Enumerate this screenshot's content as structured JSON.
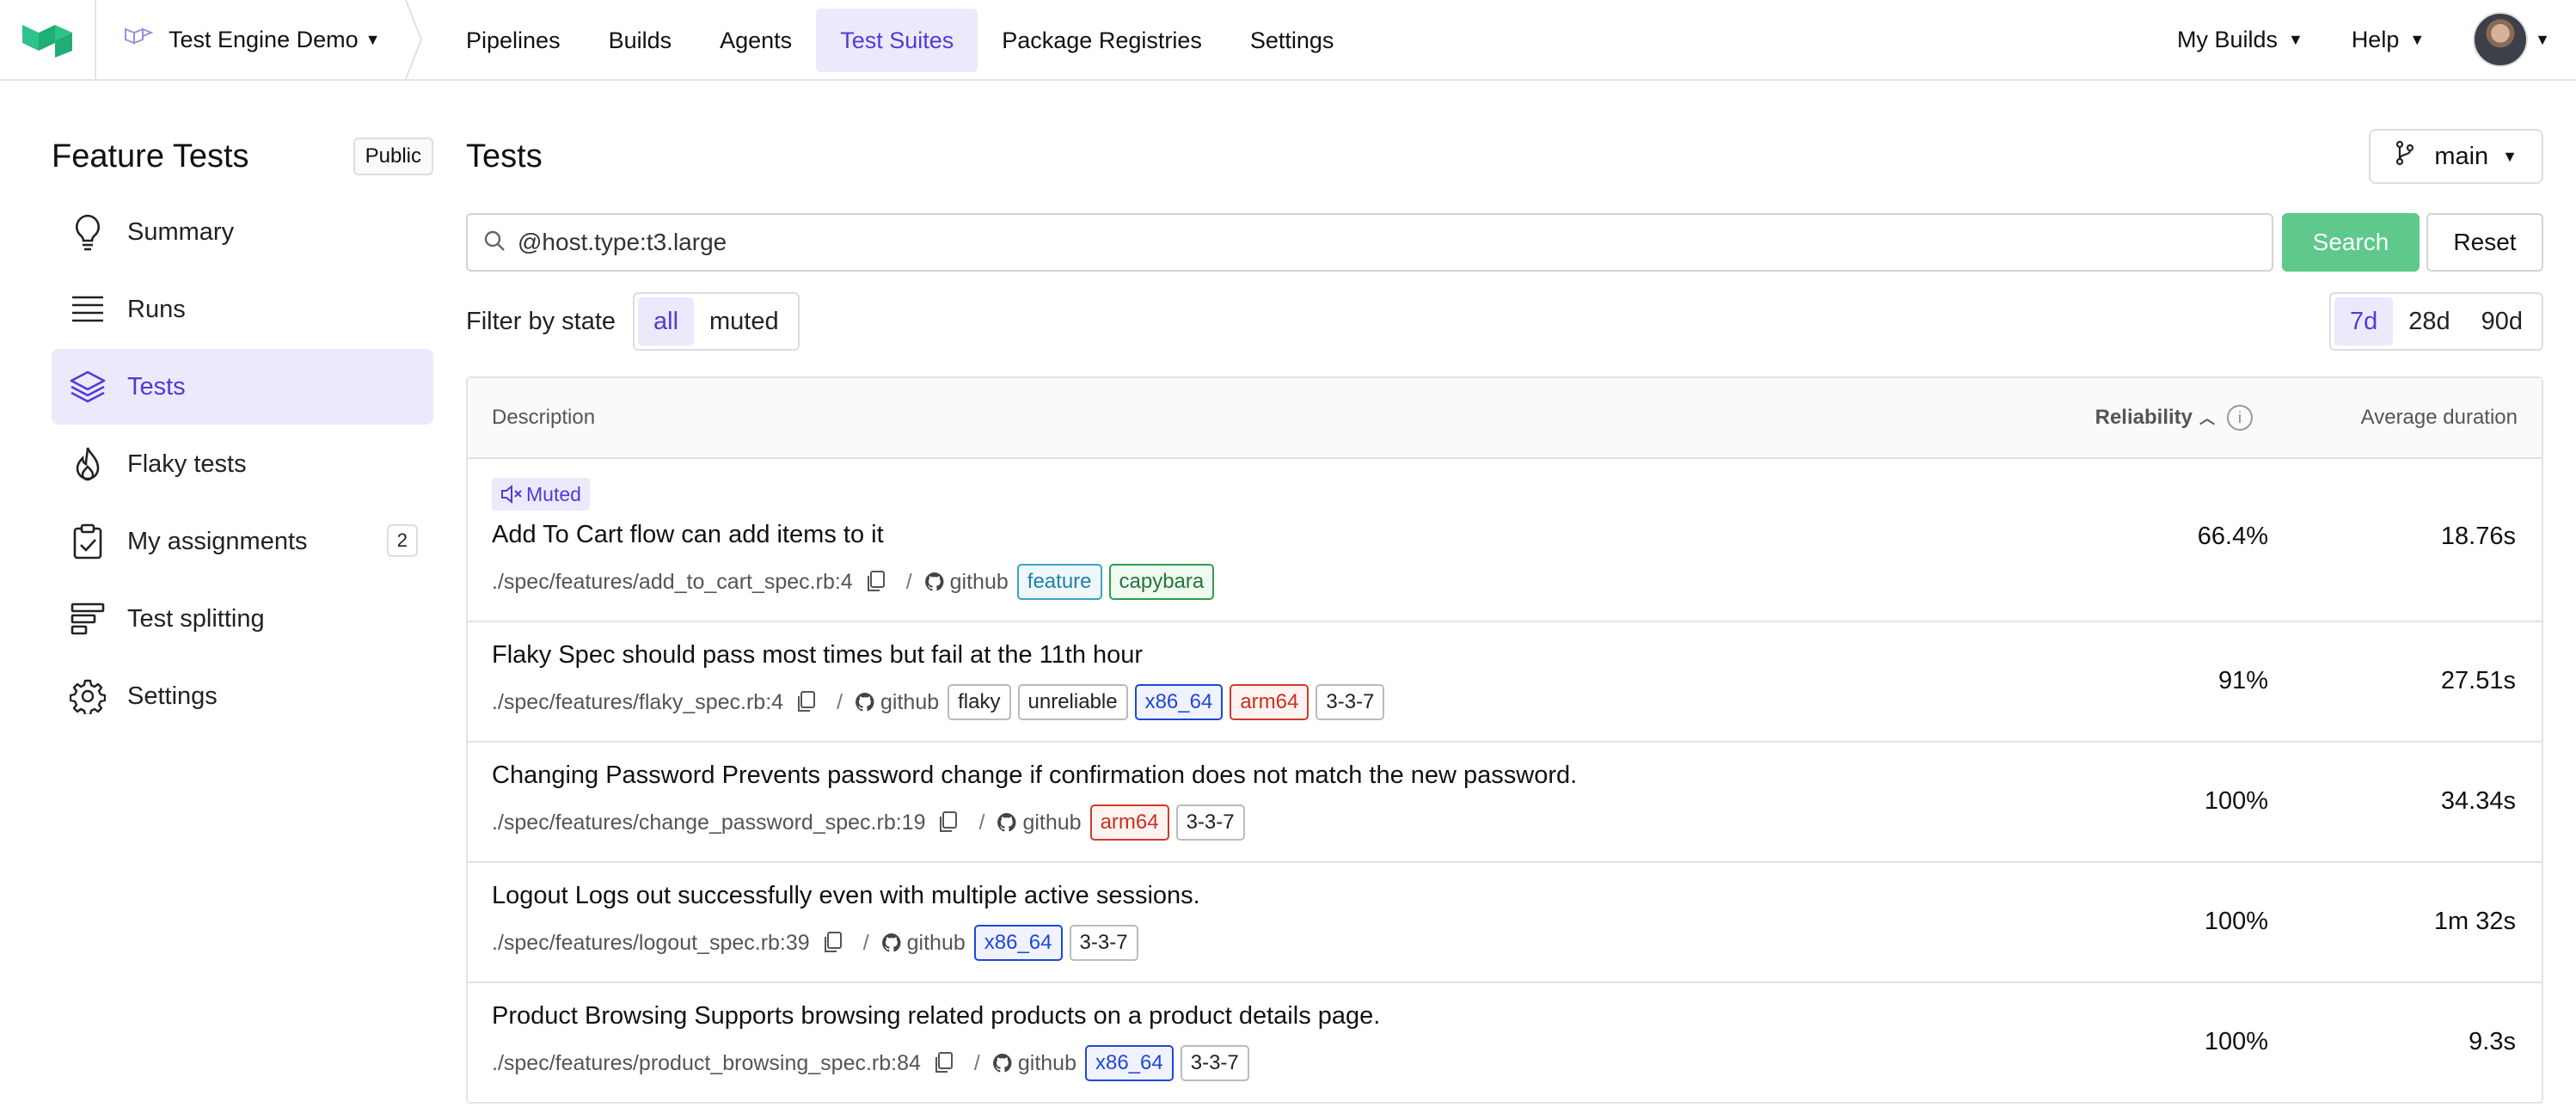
{
  "nav": {
    "org_name": "Test Engine Demo",
    "links": [
      {
        "label": "Pipelines",
        "active": false
      },
      {
        "label": "Builds",
        "active": false
      },
      {
        "label": "Agents",
        "active": false
      },
      {
        "label": "Test Suites",
        "active": true
      },
      {
        "label": "Package Registries",
        "active": false
      },
      {
        "label": "Settings",
        "active": false
      }
    ],
    "my_builds": "My Builds",
    "help": "Help"
  },
  "sidebar": {
    "suite_name": "Feature Tests",
    "visibility_badge": "Public",
    "items": [
      {
        "label": "Summary",
        "icon": "lightbulb-icon"
      },
      {
        "label": "Runs",
        "icon": "list-icon"
      },
      {
        "label": "Tests",
        "icon": "layers-icon",
        "active": true
      },
      {
        "label": "Flaky tests",
        "icon": "flame-icon"
      },
      {
        "label": "My assignments",
        "icon": "clipboard-check-icon",
        "count": "2"
      },
      {
        "label": "Test splitting",
        "icon": "split-bars-icon"
      },
      {
        "label": "Settings",
        "icon": "gear-icon"
      }
    ]
  },
  "main": {
    "title": "Tests",
    "branch": "main",
    "search_value": "@host.type:t3.large",
    "search_button": "Search",
    "reset_button": "Reset",
    "filter_label": "Filter by state",
    "state_options": [
      "all",
      "muted"
    ],
    "range_options": [
      "7d",
      "28d",
      "90d"
    ],
    "table": {
      "col_description": "Description",
      "col_reliability": "Reliability",
      "col_duration": "Average duration",
      "rows": [
        {
          "muted_label": "Muted",
          "description": "Add To Cart flow can add items to it",
          "location": "./spec/features/add_to_cart_spec.rb:4",
          "source": "github",
          "tags": [
            "feature",
            "capybara"
          ],
          "reliability": "66.4%",
          "duration": "18.76s"
        },
        {
          "description": "Flaky Spec should pass most times but fail at the 11th hour",
          "location": "./spec/features/flaky_spec.rb:4",
          "source": "github",
          "tags": [
            "flaky",
            "unreliable",
            "x86_64",
            "arm64",
            "3-3-7"
          ],
          "reliability": "91%",
          "duration": "27.51s"
        },
        {
          "description": "Changing Password Prevents password change if confirmation does not match the new password.",
          "location": "./spec/features/change_password_spec.rb:19",
          "source": "github",
          "tags": [
            "arm64",
            "3-3-7"
          ],
          "reliability": "100%",
          "duration": "34.34s"
        },
        {
          "description": "Logout Logs out successfully even with multiple active sessions.",
          "location": "./spec/features/logout_spec.rb:39",
          "source": "github",
          "tags": [
            "x86_64",
            "3-3-7"
          ],
          "reliability": "100%",
          "duration": "1m 32s"
        },
        {
          "description": "Product Browsing Supports browsing related products on a product details page.",
          "location": "./spec/features/product_browsing_spec.rb:84",
          "source": "github",
          "tags": [
            "x86_64",
            "3-3-7"
          ],
          "reliability": "100%",
          "duration": "9.3s"
        }
      ]
    }
  },
  "colors": {
    "accent": "#4f3bd8",
    "accent_bg": "#ece9fb",
    "search_button": "#5ec98a",
    "tag_x86": "#1e47d6",
    "tag_arm": "#d03a2a",
    "tag_feature": "#3aa3c7",
    "tag_capybara": "#2f9e4a"
  }
}
